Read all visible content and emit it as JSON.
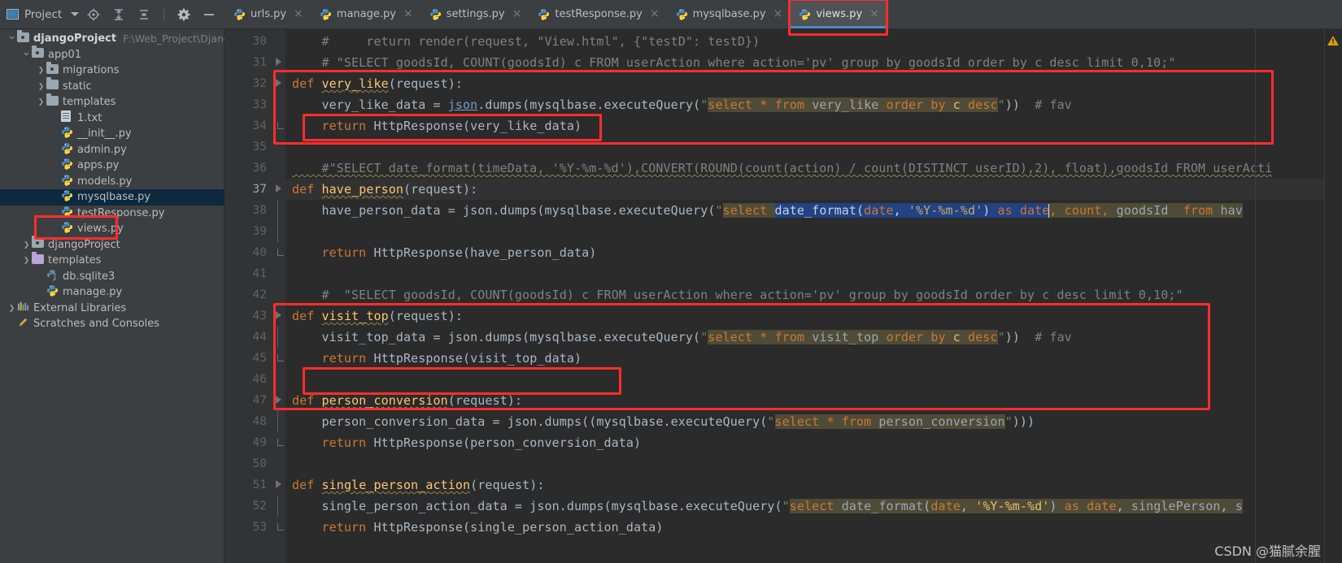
{
  "window": {
    "panel_title": "Project",
    "icons": {
      "window": "project-window-icon",
      "caret": "chevron-down-icon",
      "locate": "locate-file-icon",
      "expand_all": "expand-all-icon",
      "collapse_all": "collapse-all-icon",
      "settings": "gear-icon",
      "hide": "minimize-icon"
    }
  },
  "tabs": [
    {
      "label": "urls.py",
      "icon": "python-file-icon",
      "active": false,
      "close": "×"
    },
    {
      "label": "manage.py",
      "icon": "python-file-icon",
      "active": false,
      "close": "×"
    },
    {
      "label": "settings.py",
      "icon": "python-file-icon",
      "active": false,
      "close": "×"
    },
    {
      "label": "testResponse.py",
      "icon": "python-file-icon",
      "active": false,
      "close": "×"
    },
    {
      "label": "mysqlbase.py",
      "icon": "python-file-icon",
      "active": false,
      "close": "×"
    },
    {
      "label": "views.py",
      "icon": "python-file-icon",
      "active": true,
      "close": "×"
    }
  ],
  "tree": [
    {
      "label": "djangoProject",
      "path": "F:\\Web_Project\\Django&V",
      "icon": "folder-module-icon",
      "depth": 0,
      "arrow": "open",
      "bold": true,
      "selected": false
    },
    {
      "label": "app01",
      "path": "",
      "icon": "folder-module-icon",
      "depth": 1,
      "arrow": "open",
      "bold": false,
      "selected": false
    },
    {
      "label": "migrations",
      "path": "",
      "icon": "folder-module-icon",
      "depth": 2,
      "arrow": "closed",
      "bold": false,
      "selected": false
    },
    {
      "label": "static",
      "path": "",
      "icon": "folder-icon",
      "depth": 2,
      "arrow": "closed",
      "bold": false,
      "selected": false
    },
    {
      "label": "templates",
      "path": "",
      "icon": "folder-icon",
      "depth": 2,
      "arrow": "closed",
      "bold": false,
      "selected": false
    },
    {
      "label": "1.txt",
      "path": "",
      "icon": "text-file-icon",
      "depth": 3,
      "arrow": "none",
      "bold": false,
      "selected": false
    },
    {
      "label": "__init__.py",
      "path": "",
      "icon": "python-file-icon",
      "depth": 3,
      "arrow": "none",
      "bold": false,
      "selected": false
    },
    {
      "label": "admin.py",
      "path": "",
      "icon": "python-file-icon",
      "depth": 3,
      "arrow": "none",
      "bold": false,
      "selected": false
    },
    {
      "label": "apps.py",
      "path": "",
      "icon": "python-file-icon",
      "depth": 3,
      "arrow": "none",
      "bold": false,
      "selected": false
    },
    {
      "label": "models.py",
      "path": "",
      "icon": "python-file-icon",
      "depth": 3,
      "arrow": "none",
      "bold": false,
      "selected": false
    },
    {
      "label": "mysqlbase.py",
      "path": "",
      "icon": "python-file-icon",
      "depth": 3,
      "arrow": "none",
      "bold": false,
      "selected": true
    },
    {
      "label": "testResponse.py",
      "path": "",
      "icon": "python-file-icon",
      "depth": 3,
      "arrow": "none",
      "bold": false,
      "selected": false
    },
    {
      "label": "views.py",
      "path": "",
      "icon": "python-file-icon",
      "depth": 3,
      "arrow": "none",
      "bold": false,
      "selected": false
    },
    {
      "label": "djangoProject",
      "path": "",
      "icon": "folder-module-icon",
      "depth": 1,
      "arrow": "closed",
      "bold": false,
      "selected": false
    },
    {
      "label": "templates",
      "path": "",
      "icon": "folder-purple-icon",
      "depth": 1,
      "arrow": "closed",
      "bold": false,
      "selected": false
    },
    {
      "label": "db.sqlite3",
      "path": "",
      "icon": "db-file-icon",
      "depth": 2,
      "arrow": "none",
      "bold": false,
      "selected": false
    },
    {
      "label": "manage.py",
      "path": "",
      "icon": "python-file-icon",
      "depth": 2,
      "arrow": "none",
      "bold": false,
      "selected": false
    },
    {
      "label": "External Libraries",
      "path": "",
      "icon": "libraries-icon",
      "depth": 0,
      "arrow": "closed",
      "bold": false,
      "selected": false
    },
    {
      "label": "Scratches and Consoles",
      "path": "",
      "icon": "scratches-icon",
      "depth": 0,
      "arrow": "none",
      "bold": false,
      "selected": false
    }
  ],
  "editor": {
    "file": "views.py",
    "first_line": 30,
    "current_line": 37,
    "lines": [
      {
        "n": 30,
        "text": "    #     return render(request, \"View.html\", {\"testD\": testD})"
      },
      {
        "n": 31,
        "text": "    # \"SELECT goodsId, COUNT(goodsId) c FROM userAction where action='pv' group by goodsId order by c desc limit 0,10;\""
      },
      {
        "n": 32,
        "text": "def very_like(request):"
      },
      {
        "n": 33,
        "text": "    very_like_data = json.dumps(mysqlbase.executeQuery(\"select * from very_like order by c desc\"))  # fav"
      },
      {
        "n": 34,
        "text": "    return HttpResponse(very_like_data)"
      },
      {
        "n": 35,
        "text": ""
      },
      {
        "n": 36,
        "text": "    #\"SELECT date_format(timeData, '%Y-%m-%d'),CONVERT(ROUND(count(action) / count(DISTINCT userID),2), float),goodsId FROM userActi"
      },
      {
        "n": 37,
        "text": "def have_person(request):"
      },
      {
        "n": 38,
        "text": "    have_person_data = json.dumps(mysqlbase.executeQuery(\"select date_format(date, '%Y-%m-%d') as date, count, goodsId  from hav"
      },
      {
        "n": 39,
        "text": ""
      },
      {
        "n": 40,
        "text": "    return HttpResponse(have_person_data)"
      },
      {
        "n": 41,
        "text": ""
      },
      {
        "n": 42,
        "text": "    #  \"SELECT goodsId, COUNT(goodsId) c FROM userAction where action='pv' group by goodsId order by c desc limit 0,10;\""
      },
      {
        "n": 43,
        "text": "def visit_top(request):"
      },
      {
        "n": 44,
        "text": "    visit_top_data = json.dumps(mysqlbase.executeQuery(\"select * from visit_top order by c desc\"))  # fav"
      },
      {
        "n": 45,
        "text": "    return HttpResponse(visit_top_data)"
      },
      {
        "n": 46,
        "text": ""
      },
      {
        "n": 47,
        "text": "def person_conversion(request):"
      },
      {
        "n": 48,
        "text": "    person_conversion_data = json.dumps((mysqlbase.executeQuery(\"select * from person_conversion\")))"
      },
      {
        "n": 49,
        "text": "    return HttpResponse(person_conversion_data)"
      },
      {
        "n": 50,
        "text": ""
      },
      {
        "n": 51,
        "text": "def single_person_action(request):"
      },
      {
        "n": 52,
        "text": "    single_person_action_data = json.dumps(mysqlbase.executeQuery(\"select date_format(date, '%Y-%m-%d') as date, singlePerson, s"
      },
      {
        "n": 53,
        "text": "    return HttpResponse(single_person_action_data)"
      }
    ],
    "selection_text": "date_format(date, '%Y-%m-%d') as date",
    "warning_marker": "warning-triangle-icon"
  },
  "annotations": {
    "boxes": [
      {
        "name": "highlight-views-py-tree"
      },
      {
        "name": "highlight-views-py-tab"
      },
      {
        "name": "highlight-very-like-block"
      },
      {
        "name": "highlight-very-like-return"
      },
      {
        "name": "highlight-visit-top-block"
      },
      {
        "name": "highlight-visit-top-return"
      }
    ]
  },
  "watermark": {
    "text": "CSDN @猫腻余腥"
  }
}
